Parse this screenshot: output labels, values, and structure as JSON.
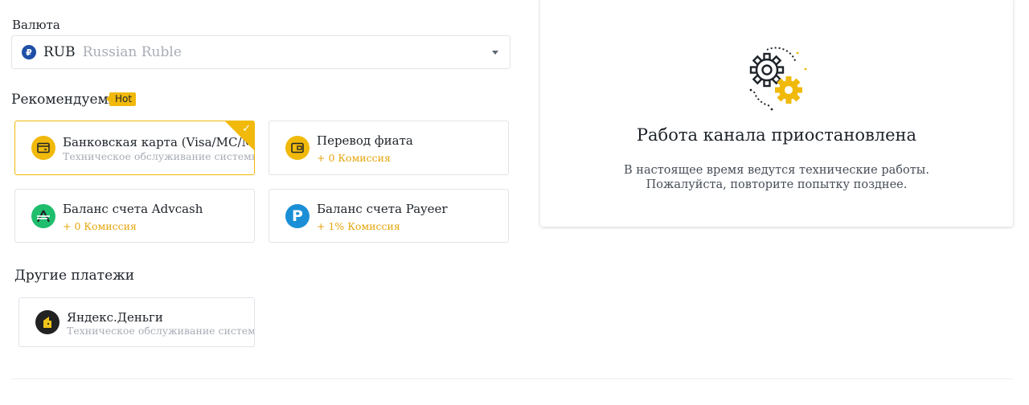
{
  "currency": {
    "label": "Валюта",
    "code": "RUB",
    "name": "Russian Ruble",
    "symbol": "₽"
  },
  "recommended": {
    "title": "Рекомендуемые",
    "badge": "Hot",
    "methods": [
      {
        "name": "Банковская карта (Visa/MC/MIR)",
        "sub": "Техническое обслуживание системы",
        "selected": true,
        "icon": "bank-card-icon"
      },
      {
        "name": "Перевод фиата",
        "sub": "+ 0 Комиссия",
        "selected": false,
        "icon": "fiat-wallet-icon"
      },
      {
        "name": "Баланс счета Advcash",
        "sub": "+ 0 Комиссия",
        "selected": false,
        "icon": "advcash-icon"
      },
      {
        "name": "Баланс счета Payeer",
        "sub": "+ 1% Комиссия",
        "selected": false,
        "icon": "payeer-icon"
      }
    ]
  },
  "other": {
    "title": "Другие платежи",
    "methods": [
      {
        "name": "Яндекс.Деньги",
        "sub": "Техническое обслуживание системы",
        "icon": "yandex-money-icon"
      }
    ]
  },
  "status_panel": {
    "title": "Работа канала приостановлена",
    "message": "В настоящее время ведутся технические работы. Пожалуйста, повторите попытку позднее.",
    "icon": "gears-maintenance-icon"
  },
  "colors": {
    "accent": "#f0b90b",
    "commission": "#e5a50b",
    "advcash": "#1fbe6e",
    "payeer": "#1a8fd6",
    "yandex": "#222222"
  }
}
